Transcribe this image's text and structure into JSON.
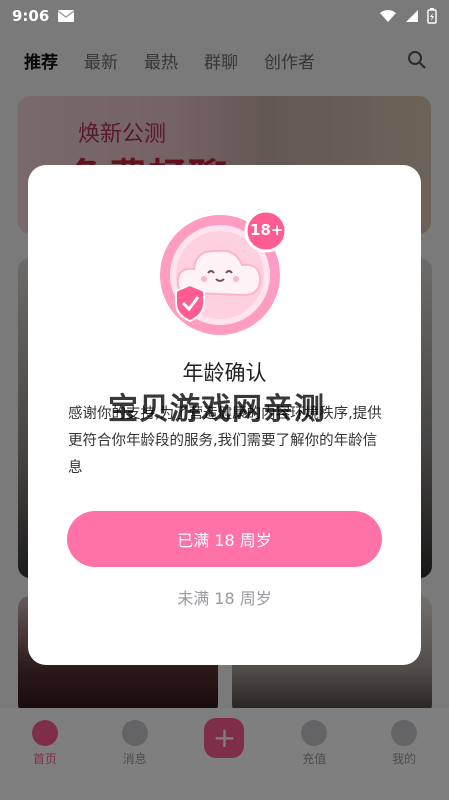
{
  "status_bar": {
    "time": "9:06"
  },
  "top_nav": {
    "tabs": [
      "推荐",
      "最新",
      "最热",
      "群聊",
      "创作者"
    ],
    "active_index": 0
  },
  "banner": {
    "text1": "焕新公测",
    "text2": "免费畅聊"
  },
  "bottom_nav": {
    "items": [
      {
        "label": "首页",
        "icon": "home-icon",
        "active": true
      },
      {
        "label": "消息",
        "icon": "message-icon",
        "active": false
      },
      {
        "label": "",
        "icon": "plus-icon",
        "active": false
      },
      {
        "label": "充值",
        "icon": "recharge-icon",
        "active": false
      },
      {
        "label": "我的",
        "icon": "profile-icon",
        "active": false
      }
    ]
  },
  "modal": {
    "badge_text": "18+",
    "title": "年龄确认",
    "body": "感谢你的支持,为了营造健康的内容环境秩序,提供更符合你年龄段的服务,我们需要了解你的年龄信息",
    "confirm_label": "已满 18 周岁",
    "decline_label": "未满 18 周岁"
  },
  "watermark": "宝贝游戏网亲测",
  "colors": {
    "accent": "#ff5c93",
    "primary_button": "#ff72a8",
    "overlay": "rgba(0,0,0,0.5)"
  }
}
